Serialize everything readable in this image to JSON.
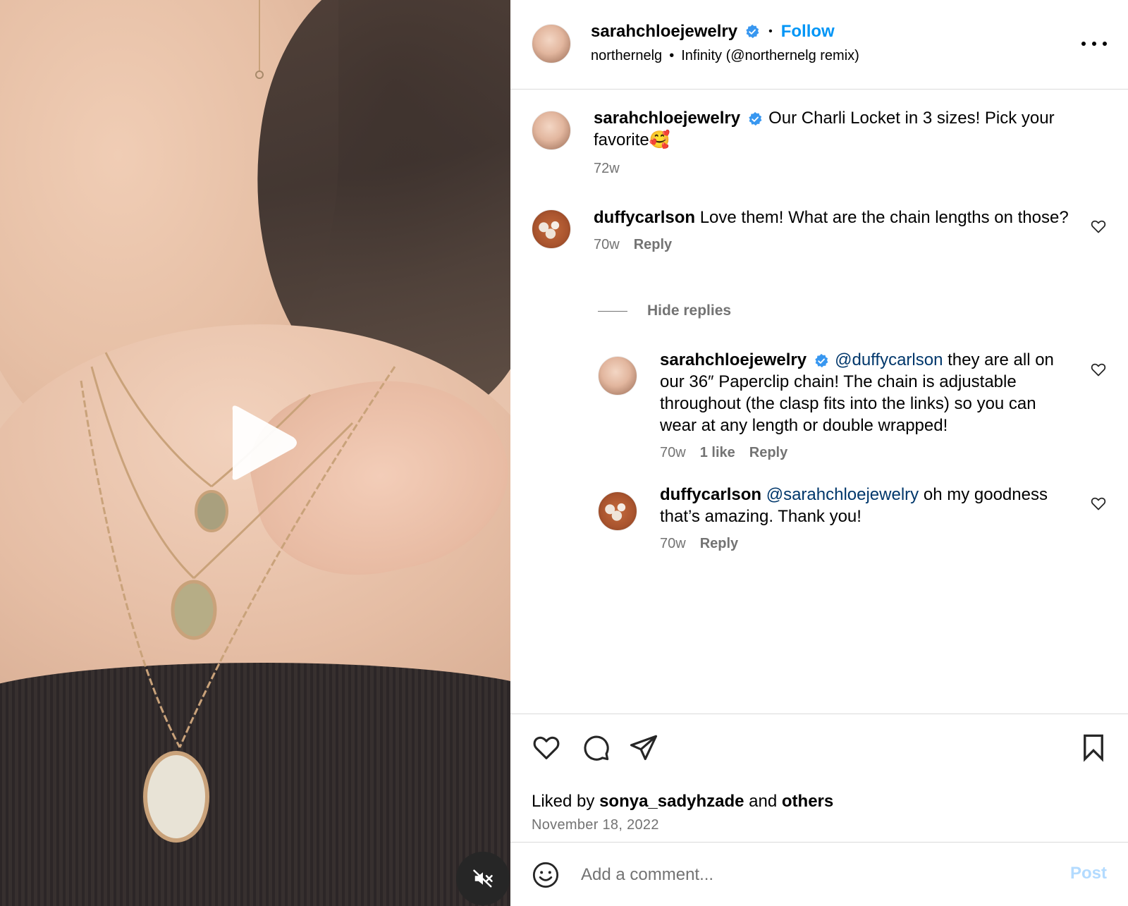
{
  "post": {
    "username": "sarahchloejewelry",
    "follow_label": "Follow",
    "audio_artist": "northernelg",
    "audio_track": "Infinity (@northernelg remix)"
  },
  "caption": {
    "username": "sarahchloejewelry",
    "text": "Our Charli Locket in 3 sizes! Pick your favorite🥰",
    "time": "72w"
  },
  "comments": [
    {
      "username": "duffycarlson",
      "text": "Love them! What are the chain lengths on those?",
      "time": "70w",
      "reply_label": "Reply"
    }
  ],
  "hide_replies_label": "Hide replies",
  "replies": [
    {
      "username": "sarahchloejewelry",
      "mention": "@duffycarlson",
      "text": "they are all on our 36″ Paperclip chain! The chain is adjustable throughout (the clasp fits into the links) so you can wear at any length or double wrapped!",
      "time": "70w",
      "likes": "1 like",
      "reply_label": "Reply"
    },
    {
      "username": "duffycarlson",
      "mention": "@sarahchloejewelry",
      "text": "oh my goodness that’s amazing. Thank you!",
      "time": "70w",
      "reply_label": "Reply"
    }
  ],
  "likes": {
    "prefix": "Liked by",
    "user": "sonya_sadyhzade",
    "and": "and",
    "others": "others"
  },
  "date": "November 18, 2022",
  "add_comment": {
    "placeholder": "Add a comment...",
    "post_label": "Post"
  },
  "icons": {
    "verified": "verified-badge-icon",
    "more": "more-options-icon",
    "heart": "heart-icon",
    "comment": "comment-icon",
    "share": "share-icon",
    "save": "bookmark-icon",
    "emoji": "emoji-icon",
    "play": "play-icon",
    "mute": "muted-speaker-icon"
  },
  "colors": {
    "accent": "#0095f6",
    "mention": "#00376b",
    "secondary_text": "#737373",
    "verified": "#3897f0",
    "post_disabled": "#b3dbff"
  }
}
